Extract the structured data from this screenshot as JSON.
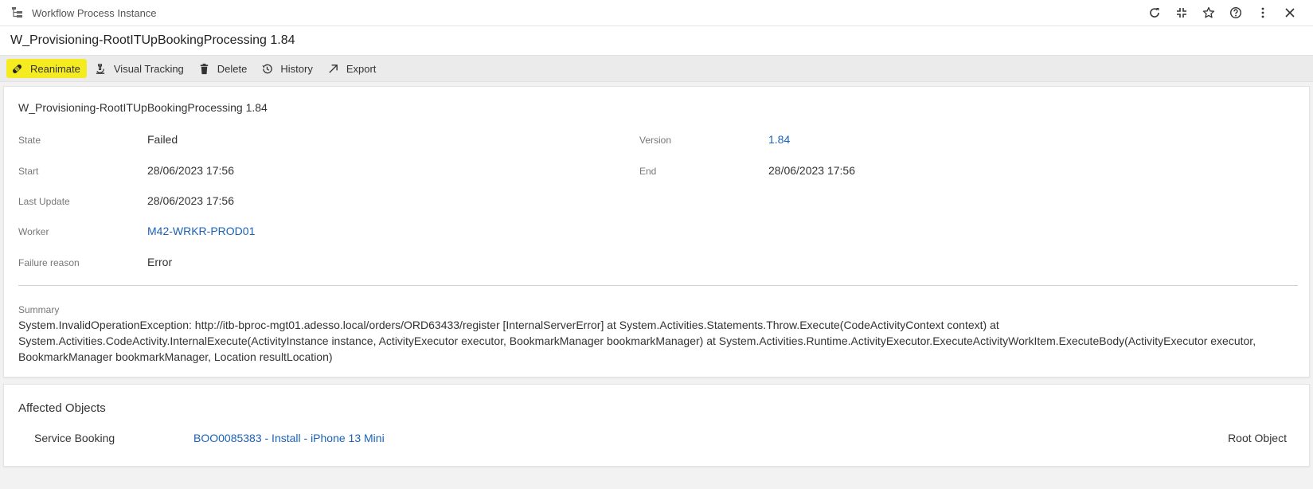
{
  "titlebar": {
    "app_title": "Workflow Process Instance",
    "icons": [
      "refresh-icon",
      "collapse-icon",
      "star-icon",
      "help-icon",
      "more-vert-icon",
      "close-icon"
    ]
  },
  "page": {
    "title": "W_Provisioning-RootITUpBookingProcessing 1.84"
  },
  "toolbar": {
    "reanimate": "Reanimate",
    "visual_tracking": "Visual Tracking",
    "delete": "Delete",
    "history": "History",
    "export": "Export",
    "highlight_color": "#f4ec21"
  },
  "details": {
    "title": "W_Provisioning-RootITUpBookingProcessing 1.84",
    "state_label": "State",
    "state_value": "Failed",
    "version_label": "Version",
    "version_value": "1.84",
    "start_label": "Start",
    "start_value": "28/06/2023 17:56",
    "end_label": "End",
    "end_value": "28/06/2023 17:56",
    "last_update_label": "Last Update",
    "last_update_value": "28/06/2023 17:56",
    "worker_label": "Worker",
    "worker_value": "M42-WRKR-PROD01",
    "failure_label": "Failure reason",
    "failure_value": "Error",
    "summary_label": "Summary",
    "summary_text": "System.InvalidOperationException: http://itb-bproc-mgt01.adesso.local/orders/ORD63433/register [InternalServerError] at System.Activities.Statements.Throw.Execute(CodeActivityContext context) at System.Activities.CodeActivity.InternalExecute(ActivityInstance instance, ActivityExecutor executor, BookmarkManager bookmarkManager) at System.Activities.Runtime.ActivityExecutor.ExecuteActivityWorkItem.ExecuteBody(ActivityExecutor executor, BookmarkManager bookmarkManager, Location resultLocation)"
  },
  "affected": {
    "title": "Affected Objects",
    "rows": [
      {
        "type": "Service Booking",
        "name": "BOO0085383 - Install - iPhone 13 Mini",
        "role": "Root Object"
      }
    ]
  },
  "colors": {
    "link": "#1a62b8"
  }
}
